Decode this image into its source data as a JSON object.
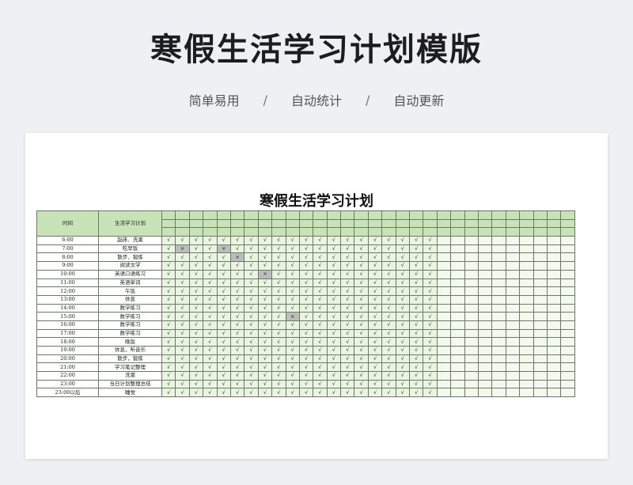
{
  "header": {
    "title": "寒假生活学习计划模版",
    "features": [
      "简单易用",
      "自动统计",
      "自动更新"
    ],
    "separator": "/"
  },
  "sheet": {
    "title": "寒假生活学习计划",
    "column_headers": {
      "time": "时间",
      "plan": "生活学习计划"
    },
    "day_columns": 30,
    "marked_columns": 20,
    "check_symbol": "√",
    "cross_symbol": "×",
    "rows": [
      {
        "time": "6:00",
        "activity": "起床、洗漱",
        "crosses": []
      },
      {
        "time": "7:00",
        "activity": "吃早饭",
        "crosses": [
          1,
          4
        ]
      },
      {
        "time": "8:00",
        "activity": "散步、锻炼",
        "crosses": [
          5
        ]
      },
      {
        "time": "9:00",
        "activity": "阅读文学",
        "crosses": []
      },
      {
        "time": "10:00",
        "activity": "英语口语练习",
        "crosses": [
          7
        ]
      },
      {
        "time": "11:00",
        "activity": "英语单词",
        "crosses": []
      },
      {
        "time": "12:00",
        "activity": "午饭",
        "crosses": []
      },
      {
        "time": "13:00",
        "activity": "休息",
        "crosses": []
      },
      {
        "time": "14:00",
        "activity": "数学练习",
        "crosses": []
      },
      {
        "time": "15:00",
        "activity": "数学练习",
        "crosses": [
          9
        ]
      },
      {
        "time": "16:00",
        "activity": "数学练习",
        "crosses": []
      },
      {
        "time": "17:00",
        "activity": "数学练习",
        "crosses": []
      },
      {
        "time": "18:00",
        "activity": "晚饭",
        "crosses": []
      },
      {
        "time": "19:00",
        "activity": "休息，听音乐",
        "crosses": []
      },
      {
        "time": "20:00",
        "activity": "散步，锻炼",
        "crosses": []
      },
      {
        "time": "21:00",
        "activity": "学习笔记整理",
        "crosses": []
      },
      {
        "time": "22:00",
        "activity": "洗漱",
        "crosses": []
      },
      {
        "time": "23:00",
        "activity": "当日计划整理总结",
        "crosses": []
      },
      {
        "time": "23:00以后",
        "activity": "睡觉",
        "crosses": []
      }
    ]
  }
}
